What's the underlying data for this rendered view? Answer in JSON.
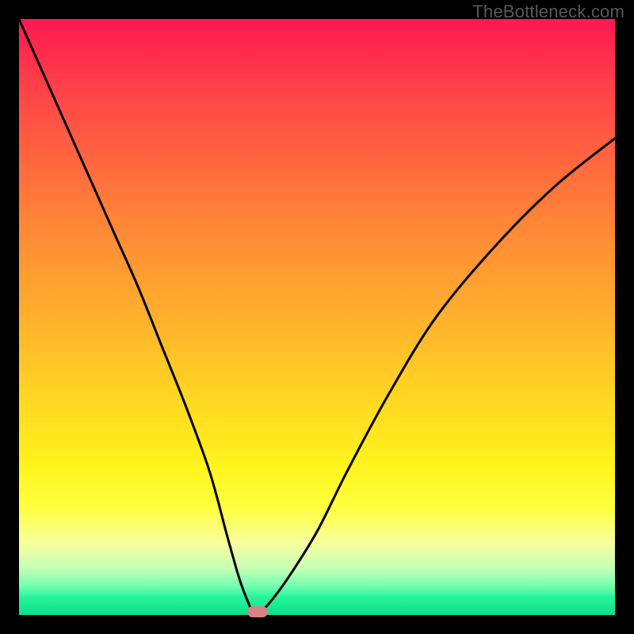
{
  "watermark": "TheBottleneck.com",
  "chart_data": {
    "type": "line",
    "title": "",
    "xlabel": "",
    "ylabel": "",
    "xlim": [
      0,
      100
    ],
    "ylim": [
      0,
      100
    ],
    "grid": false,
    "legend": false,
    "x": [
      0,
      4,
      8,
      12,
      16,
      20,
      24,
      28,
      32,
      35,
      37,
      38.5,
      39.5,
      40.5,
      42,
      45,
      50,
      55,
      62,
      70,
      80,
      90,
      100
    ],
    "y": [
      100,
      91,
      82,
      73,
      64,
      55,
      45,
      35,
      24,
      13,
      6,
      2,
      0,
      0.5,
      2,
      6,
      14,
      24,
      37,
      50,
      62,
      72,
      80
    ],
    "background_gradient": {
      "orientation": "vertical",
      "stops": [
        {
          "pos": 0.0,
          "color": "#ff1850"
        },
        {
          "pos": 0.5,
          "color": "#ffd223"
        },
        {
          "pos": 0.82,
          "color": "#feff3f"
        },
        {
          "pos": 1.0,
          "color": "#0adf8c"
        }
      ]
    },
    "marker": {
      "x": 40,
      "y": 0.5,
      "color": "#d98183",
      "shape": "capsule"
    },
    "line_color": "#000000"
  }
}
